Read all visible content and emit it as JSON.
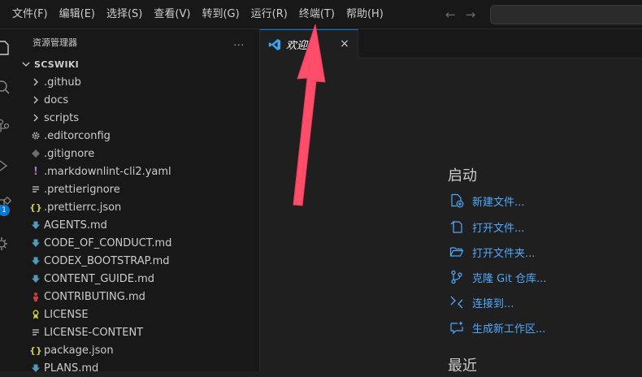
{
  "menubar": {
    "items": [
      "文件(F)",
      "编辑(E)",
      "选择(S)",
      "查看(V)",
      "转到(G)",
      "运行(R)",
      "终端(T)",
      "帮助(H)"
    ]
  },
  "sidebar": {
    "title": "资源管理器",
    "more": "...",
    "root": "SCSWIKI",
    "items": [
      {
        "label": ".github",
        "type": "folder",
        "icon": "chevron-right-icon"
      },
      {
        "label": "docs",
        "type": "folder",
        "icon": "chevron-right-icon"
      },
      {
        "label": "scripts",
        "type": "folder",
        "icon": "chevron-right-icon"
      },
      {
        "label": ".editorconfig",
        "type": "file",
        "icon": "gear-icon",
        "color": "#a9a9a9"
      },
      {
        "label": ".gitignore",
        "type": "file",
        "icon": "git-diamond-icon",
        "color": "#6d6d6d"
      },
      {
        "label": ".markdownlint-cli2.yaml",
        "type": "file",
        "icon": "exclamation-icon",
        "color": "#a074c4"
      },
      {
        "label": ".prettierignore",
        "type": "file",
        "icon": "lines-icon",
        "color": "#cccccc"
      },
      {
        "label": ".prettierrc.json",
        "type": "file",
        "icon": "braces-icon",
        "color": "#cbcb41"
      },
      {
        "label": "AGENTS.md",
        "type": "file",
        "icon": "markdown-arrow-icon",
        "color": "#519aba"
      },
      {
        "label": "CODE_OF_CONDUCT.md",
        "type": "file",
        "icon": "markdown-arrow-icon",
        "color": "#519aba"
      },
      {
        "label": "CODEX_BOOTSTRAP.md",
        "type": "file",
        "icon": "markdown-arrow-icon",
        "color": "#519aba"
      },
      {
        "label": "CONTENT_GUIDE.md",
        "type": "file",
        "icon": "markdown-arrow-icon",
        "color": "#519aba"
      },
      {
        "label": "CONTRIBUTING.md",
        "type": "file",
        "icon": "person-icon",
        "color": "#cc3e44"
      },
      {
        "label": "LICENSE",
        "type": "file",
        "icon": "license-icon",
        "color": "#cbcb41"
      },
      {
        "label": "LICENSE-CONTENT",
        "type": "file",
        "icon": "lines-icon",
        "color": "#cccccc"
      },
      {
        "label": "package.json",
        "type": "file",
        "icon": "braces-icon",
        "color": "#cbcb41"
      },
      {
        "label": "PLANS.md",
        "type": "file",
        "icon": "markdown-arrow-icon",
        "color": "#519aba"
      }
    ]
  },
  "activity": {
    "badge": "1"
  },
  "tabs": [
    {
      "label": "欢迎",
      "close": "×"
    }
  ],
  "welcome": {
    "start_title": "启动",
    "actions": [
      {
        "label": "新建文件...",
        "icon": "new-file-icon"
      },
      {
        "label": "打开文件...",
        "icon": "open-file-icon"
      },
      {
        "label": "打开文件夹...",
        "icon": "open-folder-icon"
      },
      {
        "label": "克隆 Git 仓库...",
        "icon": "git-clone-icon"
      },
      {
        "label": "连接到...",
        "icon": "remote-connect-icon"
      },
      {
        "label": "生成新工作区...",
        "icon": "new-workspace-icon"
      }
    ],
    "recent_title": "最近"
  },
  "colors": {
    "accent": "#0078d4",
    "link": "#4daafc",
    "annotation_arrow": "#ff4d6a"
  }
}
